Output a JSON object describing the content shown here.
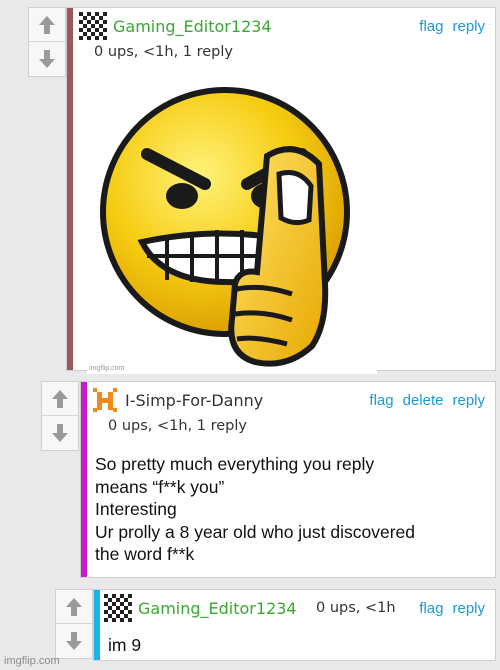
{
  "comments": [
    {
      "username": "Gaming_Editor1234",
      "username_color": "#3aa832",
      "stripe_color": "#9b5a5a",
      "meta": "0 ups, <1h, 1 reply",
      "actions": [
        "flag",
        "reply"
      ],
      "avatar_icon": "checkerboard-avatar-icon",
      "image_watermark": "imgflip.com",
      "image_alt": "angry emoji middle finger"
    },
    {
      "username": "I-Simp-For-Danny",
      "username_color": "#333333",
      "stripe_color": "#c81ec8",
      "meta": "0 ups, <1h, 1 reply",
      "actions": [
        "flag",
        "delete",
        "reply"
      ],
      "avatar_icon": "orange-h-avatar-icon",
      "body_lines": [
        "So pretty much everything you reply",
        "means “f**k you”",
        "Interesting",
        "Ur prolly a 8 year old who just discovered",
        "the word f**k"
      ]
    },
    {
      "username": "Gaming_Editor1234",
      "username_color": "#3aa832",
      "stripe_color": "#19b4e6",
      "meta": "0 ups, <1h",
      "actions": [
        "flag",
        "reply"
      ],
      "avatar_icon": "checkerboard-avatar-icon",
      "body_lines": [
        "im 9"
      ]
    }
  ],
  "footer_watermark": "imgflip.com",
  "colors": {
    "link": "#1a9ad6",
    "background": "#e9e9e9"
  }
}
